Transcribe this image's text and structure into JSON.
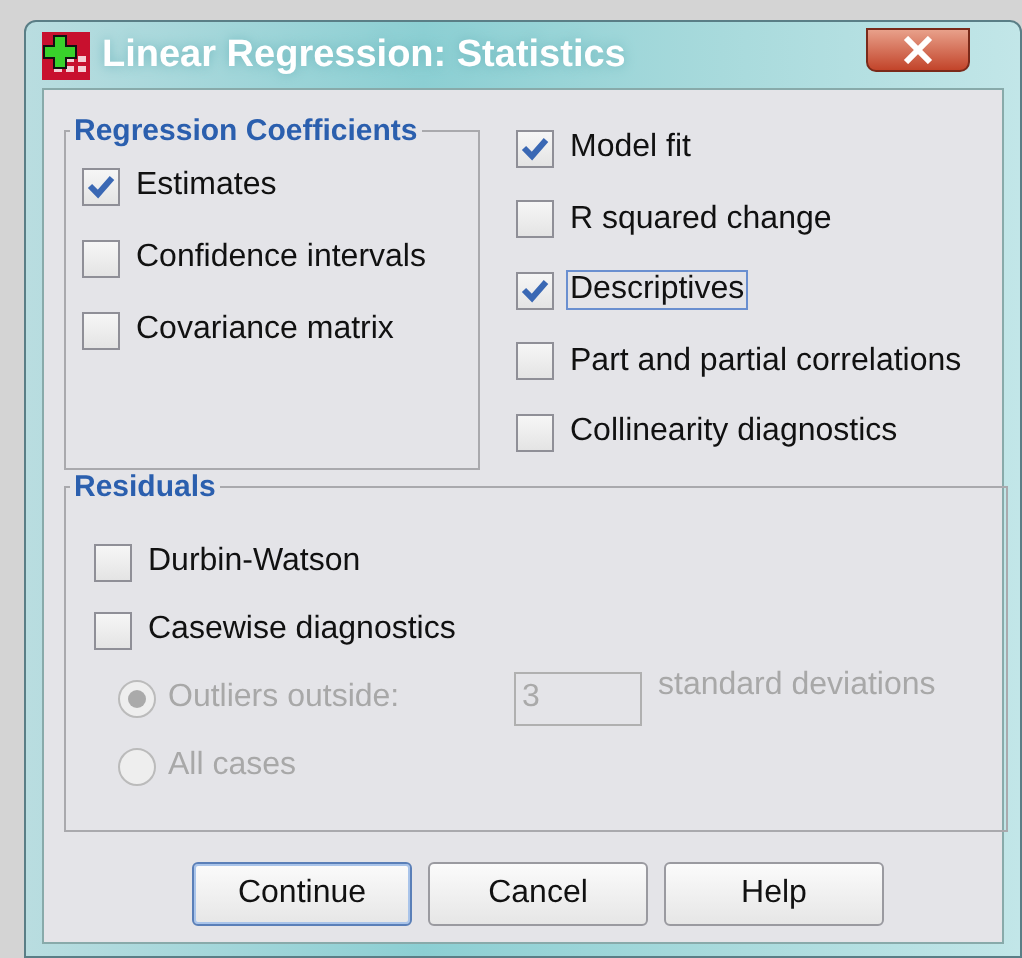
{
  "window": {
    "title": "Linear Regression: Statistics"
  },
  "coefficients": {
    "title": "Regression Coefficients",
    "options": [
      {
        "label": "Estimates",
        "checked": true
      },
      {
        "label": "Confidence intervals",
        "checked": false
      },
      {
        "label": "Covariance matrix",
        "checked": false
      }
    ]
  },
  "options": [
    {
      "label": "Model fit",
      "checked": true,
      "focused": false
    },
    {
      "label": "R squared change",
      "checked": false,
      "focused": false
    },
    {
      "label": "Descriptives",
      "checked": true,
      "focused": true
    },
    {
      "label": "Part and partial correlations",
      "checked": false,
      "focused": false
    },
    {
      "label": "Collinearity diagnostics",
      "checked": false,
      "focused": false
    }
  ],
  "residuals": {
    "title": "Residuals",
    "checks": [
      {
        "label": "Durbin-Watson",
        "checked": false
      },
      {
        "label": "Casewise diagnostics",
        "checked": false
      }
    ],
    "radios": [
      {
        "label": "Outliers outside:",
        "selected": true,
        "disabled": true
      },
      {
        "label": "All cases",
        "selected": false,
        "disabled": true
      }
    ],
    "outlier_field": {
      "value": "3",
      "disabled": true
    },
    "outlier_unit": "standard deviations"
  },
  "buttons": [
    {
      "label": "Continue",
      "default": true
    },
    {
      "label": "Cancel",
      "default": false
    },
    {
      "label": "Help",
      "default": false
    }
  ]
}
